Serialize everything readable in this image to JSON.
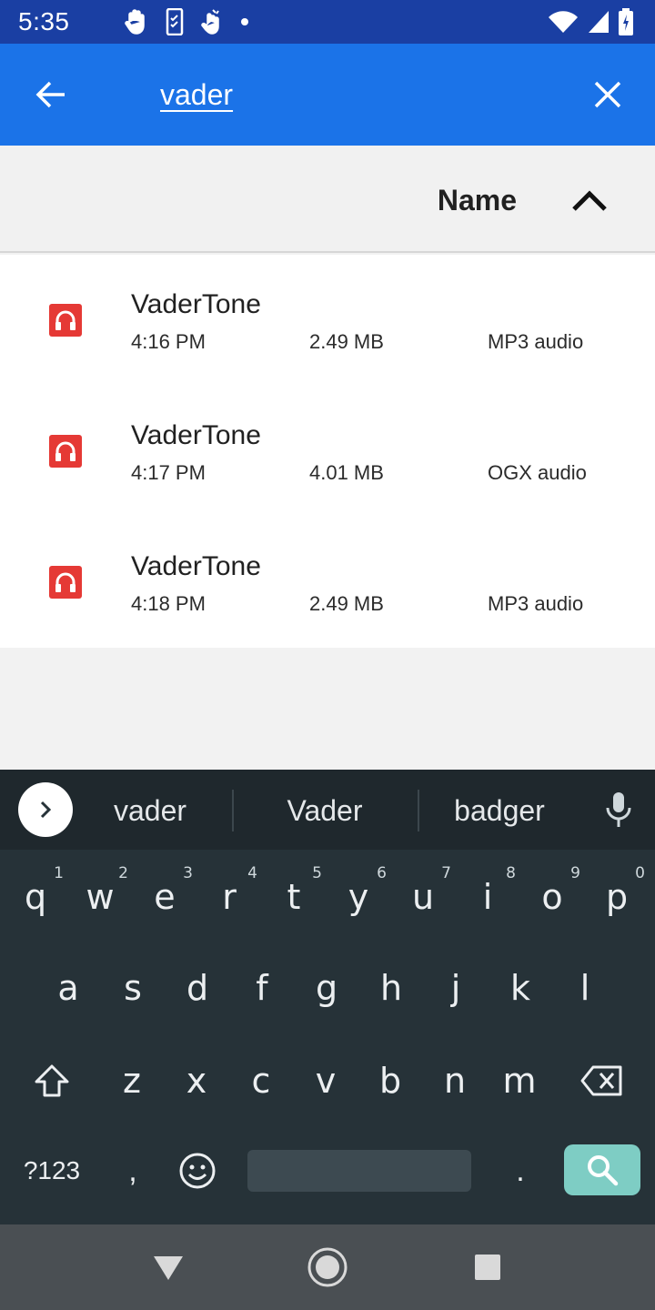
{
  "status_bar": {
    "time": "5:35",
    "left_icons": [
      "hand-icon",
      "phone-checklist-icon",
      "gesture-icon",
      "dot-icon"
    ],
    "right_icons": [
      "wifi-icon",
      "signal-icon",
      "battery-icon"
    ]
  },
  "app_bar": {
    "search_value": "vader",
    "back_icon": "arrow-left-icon",
    "clear_icon": "close-icon"
  },
  "sort": {
    "label": "Name",
    "direction_icon": "chevron-up-icon"
  },
  "results": [
    {
      "name": "VaderTone",
      "time": "4:16 PM",
      "size": "2.49 MB",
      "type": "MP3 audio",
      "icon": "headphones-icon"
    },
    {
      "name": "VaderTone",
      "time": "4:17 PM",
      "size": "4.01 MB",
      "type": "OGX audio",
      "icon": "headphones-icon"
    },
    {
      "name": "VaderTone",
      "time": "4:18 PM",
      "size": "2.49 MB",
      "type": "MP3 audio",
      "icon": "headphones-icon"
    }
  ],
  "keyboard": {
    "suggestions": [
      "vader",
      "Vader",
      "badger"
    ],
    "row1": [
      "q",
      "w",
      "e",
      "r",
      "t",
      "y",
      "u",
      "i",
      "o",
      "p"
    ],
    "row1_hints": [
      "1",
      "2",
      "3",
      "4",
      "5",
      "6",
      "7",
      "8",
      "9",
      "0"
    ],
    "row2": [
      "a",
      "s",
      "d",
      "f",
      "g",
      "h",
      "j",
      "k",
      "l"
    ],
    "row3": [
      "z",
      "x",
      "c",
      "v",
      "b",
      "n",
      "m"
    ],
    "symbols_label": "?123",
    "comma_label": ",",
    "period_label": "."
  },
  "colors": {
    "status_bar": "#1a3fa3",
    "app_bar": "#1b73e8",
    "file_icon": "#e53935",
    "keyboard_bg": "#263238",
    "search_key": "#7ecdc4"
  }
}
